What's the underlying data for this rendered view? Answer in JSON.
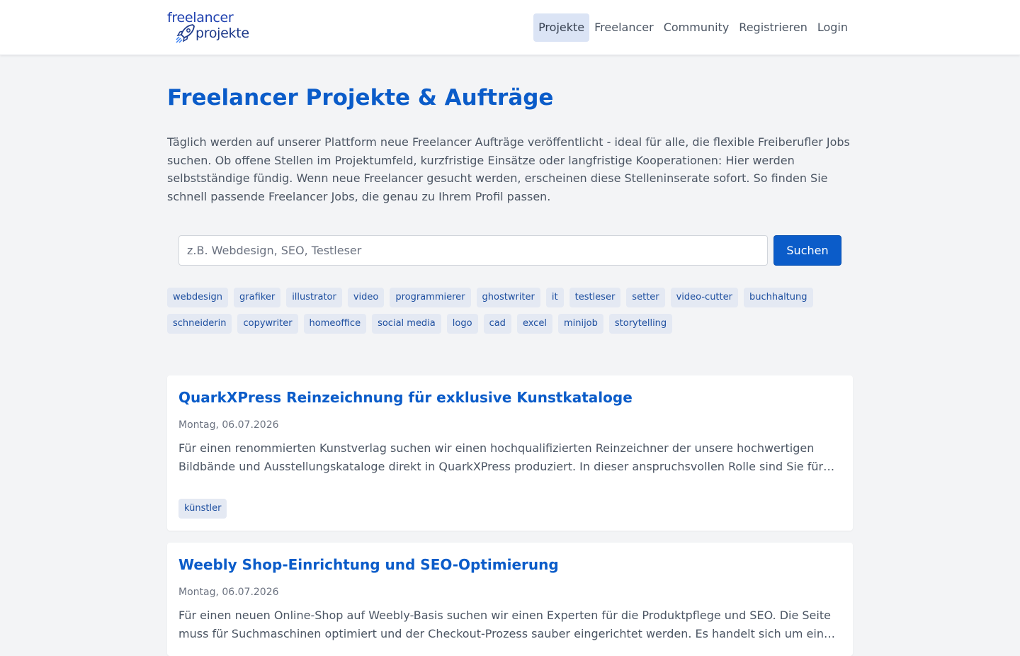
{
  "brand": {
    "line1": "freelancer",
    "line2": "projekte"
  },
  "nav": [
    {
      "label": "Projekte",
      "active": true
    },
    {
      "label": "Freelancer",
      "active": false
    },
    {
      "label": "Community",
      "active": false
    },
    {
      "label": "Registrieren",
      "active": false
    },
    {
      "label": "Login",
      "active": false
    }
  ],
  "page": {
    "title": "Freelancer Projekte & Aufträge",
    "intro": "Täglich werden auf unserer Plattform neue Freelancer Aufträge veröffentlicht - ideal für alle, die flexible Freiberufler Jobs suchen. Ob offene Stellen im Projektumfeld, kurzfristige Einsätze oder langfristige Kooperationen: Hier werden selbstständige fündig. Wenn neue Freelancer gesucht werden, erscheinen diese Stelleninserate sofort. So finden Sie schnell passende Freelancer Jobs, die genau zu Ihrem Profil passen."
  },
  "search": {
    "placeholder": "z.B. Webdesign, SEO, Testleser",
    "value": "",
    "button_label": "Suchen"
  },
  "tags": {
    "row1": [
      "webdesign",
      "grafiker",
      "illustrator",
      "video",
      "programmierer",
      "ghostwriter",
      "it",
      "testleser",
      "setter",
      "video-cutter",
      "buchhaltung"
    ],
    "row2": [
      "schneiderin",
      "copywriter",
      "homeoffice",
      "social media",
      "logo",
      "cad",
      "excel",
      "minijob",
      "storytelling"
    ]
  },
  "projects": [
    {
      "title": "QuarkXPress Reinzeichnung für exklusive Kunstkataloge",
      "date": "Montag, 06.07.2026",
      "description": "Für einen renommierten Kunstverlag suchen wir einen hochqualifizierten Reinzeichner der unsere hochwertigen Bildbände und Ausstellungskataloge direkt in QuarkXPress produziert. In dieser anspruchsvollen Rolle sind Sie für die Umsetzung verantwortlich.",
      "tag": "künstler"
    },
    {
      "title": "Weebly Shop-Einrichtung und SEO-Optimierung",
      "date": "Montag, 06.07.2026",
      "description": "Für einen neuen Online-Shop auf Weebly-Basis suchen wir einen Experten für die Produktpflege und SEO. Die Seite muss für Suchmaschinen optimiert und der Checkout-Prozess sauber eingerichtet werden. Es handelt sich um ein spannendes Projekt.",
      "tag": ""
    }
  ],
  "colors": {
    "primary": "#0b5cc9",
    "tag_bg": "#e4e9f3",
    "page_bg": "#f3f4f6"
  }
}
